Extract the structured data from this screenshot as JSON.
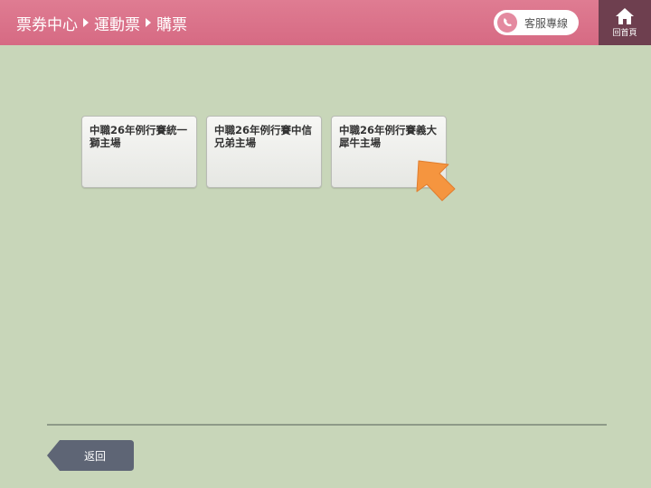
{
  "header": {
    "breadcrumb": [
      "票券中心",
      "運動票",
      "購票"
    ],
    "hotline_label": "客服專線",
    "home_label": "回首頁"
  },
  "venues": [
    {
      "title": "中職26年例行賽統一獅主場"
    },
    {
      "title": "中職26年例行賽中信兄弟主場"
    },
    {
      "title": "中職26年例行賽義大犀牛主場"
    }
  ],
  "footer": {
    "back_label": "返回"
  },
  "colors": {
    "header_pink": "#d66a83",
    "home_bg": "#6e3f4f",
    "page_bg": "#c8d6b9",
    "back_button": "#5e6575",
    "pointer_arrow": "#f5953f"
  },
  "icons": {
    "hotline": "phone-icon",
    "home": "home-icon",
    "pointer": "pointer-arrow-icon"
  }
}
